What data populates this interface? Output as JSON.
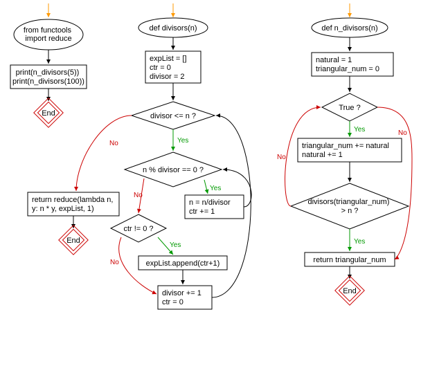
{
  "colors": {
    "yes_arrow": "#009900",
    "no_arrow": "#cc0000",
    "entry_arrow": "#ff9900",
    "normal_arrow": "#000000",
    "end_node": "#cc0000"
  },
  "flowchart_a": {
    "entry_label": "from functools\nimport reduce",
    "call_block": "print(n_divisors(5))\nprint(n_divisors(100))",
    "end": "End"
  },
  "flowchart_b": {
    "func_header": "def divisors(n)",
    "init_block": "expList = []\nctr = 0\ndivisor = 2",
    "cond_divisor_le_n": "divisor <= n ?",
    "cond_mod": "n % divisor == 0 ?",
    "assign_div": "n = n/divisor\nctr += 1",
    "cond_ctr": "ctr != 0 ?",
    "append_block": "expList.append(ctr+1)",
    "inc_divisor": "divisor += 1\nctr = 0",
    "return_block": "return reduce(lambda n,\ny: n * y, expList, 1)",
    "end": "End",
    "yes": "Yes",
    "no": "No"
  },
  "flowchart_c": {
    "func_header": "def n_divisors(n)",
    "init_block": "natural = 1\ntriangular_num = 0",
    "cond_true": "True ?",
    "body_block": "triangular_num += natural\nnatural += 1",
    "cond_divisors": "divisors(triangular_num)\n> n ?",
    "return_block": "return triangular_num",
    "end": "End",
    "yes": "Yes",
    "no": "No"
  }
}
